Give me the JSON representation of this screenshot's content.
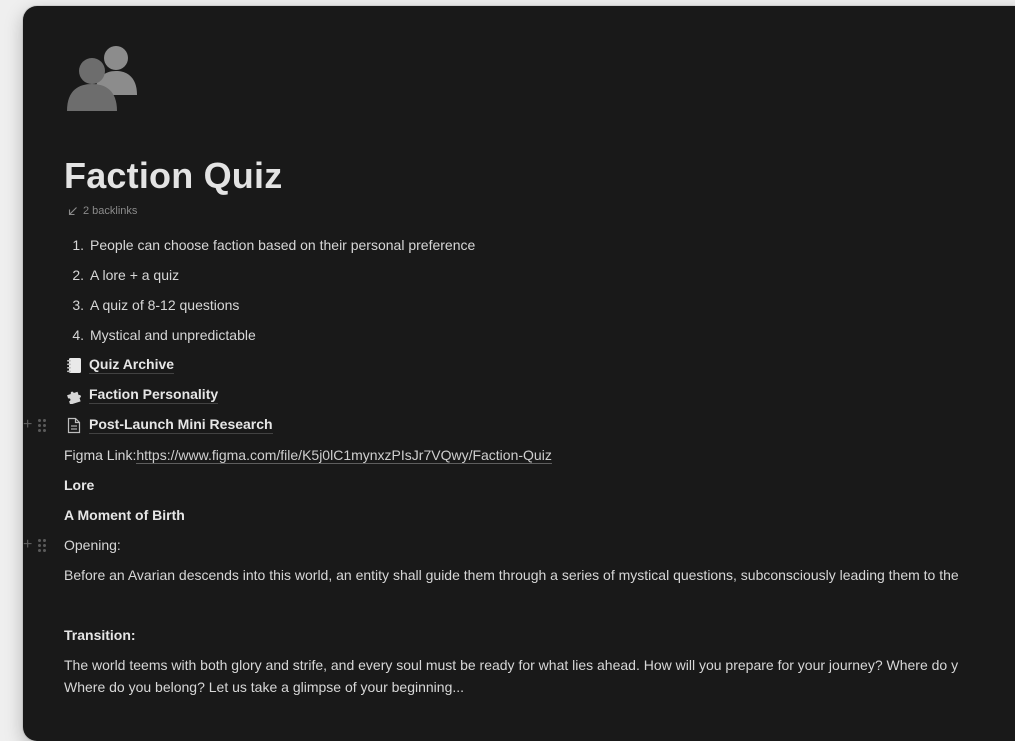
{
  "page": {
    "icon": "silhouettes-icon",
    "title": "Faction Quiz",
    "backlinks": "2 backlinks"
  },
  "numbered_list": [
    {
      "num": "1.",
      "text": "People can choose faction based on their personal preference"
    },
    {
      "num": "2.",
      "text": "A lore + a quiz"
    },
    {
      "num": "3.",
      "text": "A quiz of 8-12 questions"
    },
    {
      "num": "4.",
      "text": "Mystical and unpredictable"
    }
  ],
  "page_links": [
    {
      "icon": "notebook-icon",
      "label": "Quiz Archive"
    },
    {
      "icon": "puzzle-icon",
      "label": "Faction Personality"
    },
    {
      "icon": "document-icon",
      "label": "Post-Launch Mini Research"
    }
  ],
  "figma": {
    "label": "Figma Link: ",
    "url": "https://www.figma.com/file/K5j0lC1mynxzPIsJr7VQwy/Faction-Quiz"
  },
  "lore_heading": "Lore",
  "moment_heading": "A Moment of Birth",
  "opening_label": "Opening:",
  "opening_text": "Before an Avarian descends into this world, an entity shall guide them through a series of mystical questions, subconsciously leading them to the",
  "transition_label": "Transition:",
  "transition_line1": "The world teems with both glory and strife, and every soul must be ready for what lies ahead. How will you prepare for your journey? Where do y",
  "transition_line2": "Where do you belong? Let us take a glimpse of your beginning...",
  "colors": {
    "background": "#191919",
    "text": "#d7d7d7",
    "muted": "#8b8b8b",
    "outer": "#efefef"
  }
}
